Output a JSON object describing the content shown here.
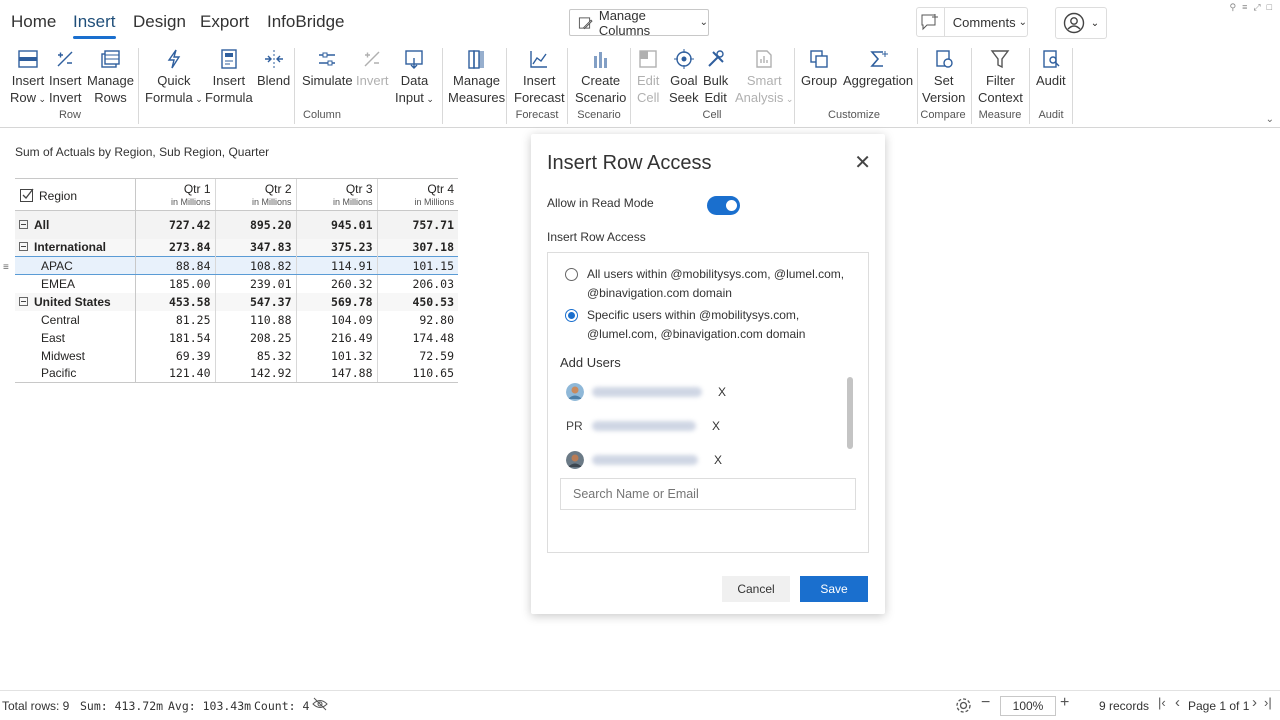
{
  "menu": {
    "tabs": [
      "Home",
      "Insert",
      "Design",
      "Export",
      "InfoBridge"
    ],
    "active": "Insert",
    "manage_columns": "Manage Columns",
    "comments": "Comments"
  },
  "ribbon": {
    "insert_row": [
      "Insert",
      "Row"
    ],
    "invert": [
      "Insert",
      "Invert"
    ],
    "manage_rows": [
      "Manage",
      "Rows"
    ],
    "quick_formula": [
      "Quick",
      "Formula"
    ],
    "insert_formula": [
      "Insert",
      "Formula"
    ],
    "blend": "Blend",
    "simulate": "Simulate",
    "invert_col": "Invert",
    "data_input": [
      "Data",
      "Input"
    ],
    "manage_measures": [
      "Manage",
      "Measures"
    ],
    "insert_forecast": [
      "Insert",
      "Forecast"
    ],
    "create_scenario": [
      "Create",
      "Scenario"
    ],
    "edit_cell": [
      "Edit",
      "Cell"
    ],
    "goal_seek": [
      "Goal",
      "Seek"
    ],
    "bulk_edit": [
      "Bulk",
      "Edit"
    ],
    "smart_analysis": [
      "Smart",
      "Analysis"
    ],
    "group": "Group",
    "aggregation": "Aggregation",
    "set_version": [
      "Set",
      "Version"
    ],
    "filter_context": [
      "Filter",
      "Context"
    ],
    "audit": "Audit",
    "groups": {
      "row": "Row",
      "column": "Column",
      "forecast": "Forecast",
      "scenario": "Scenario",
      "cell": "Cell",
      "customize": "Customize",
      "compare": "Compare",
      "measure": "Measure",
      "audit": "Audit"
    }
  },
  "table": {
    "title": "Sum of Actuals by Region, Sub Region, Quarter",
    "region_header": "Region",
    "unit": "in Millions",
    "quarters": [
      "Qtr 1",
      "Qtr 2",
      "Qtr 3",
      "Qtr 4"
    ],
    "rows": [
      {
        "label": "All",
        "values": [
          "727.42",
          "895.20",
          "945.01",
          "757.71"
        ]
      },
      {
        "label": "International",
        "values": [
          "273.84",
          "347.83",
          "375.23",
          "307.18"
        ]
      },
      {
        "label": "APAC",
        "values": [
          "88.84",
          "108.82",
          "114.91",
          "101.15"
        ]
      },
      {
        "label": "EMEA",
        "values": [
          "185.00",
          "239.01",
          "260.32",
          "206.03"
        ]
      },
      {
        "label": "United States",
        "values": [
          "453.58",
          "547.37",
          "569.78",
          "450.53"
        ]
      },
      {
        "label": "Central",
        "values": [
          "81.25",
          "110.88",
          "104.09",
          "92.80"
        ]
      },
      {
        "label": "East",
        "values": [
          "181.54",
          "208.25",
          "216.49",
          "174.48"
        ]
      },
      {
        "label": "Midwest",
        "values": [
          "69.39",
          "85.32",
          "101.32",
          "72.59"
        ]
      },
      {
        "label": "Pacific",
        "values": [
          "121.40",
          "142.92",
          "147.88",
          "110.65"
        ]
      }
    ]
  },
  "dialog": {
    "title": "Insert Row Access",
    "allow_read_mode": "Allow in Read Mode",
    "section_label": "Insert Row Access",
    "option_all": "All users within @mobilitysys.com, @lumel.com, @binavigation.com domain",
    "option_specific": "Specific users within @mobilitysys.com, @lumel.com, @binavigation.com domain",
    "add_users": "Add Users",
    "user_initials": "PR",
    "remove": "X",
    "search_placeholder": "Search Name or Email",
    "cancel": "Cancel",
    "save": "Save"
  },
  "status": {
    "total_rows": "Total rows: 9",
    "sum": "Sum: 413.72m",
    "avg": "Avg: 103.43m",
    "count": "Count: 4",
    "zoom": "100%",
    "records": "9 records",
    "page": "Page 1 of 1"
  },
  "colors": {
    "accent": "#1a6fce",
    "selection": "#e8f1fb"
  }
}
